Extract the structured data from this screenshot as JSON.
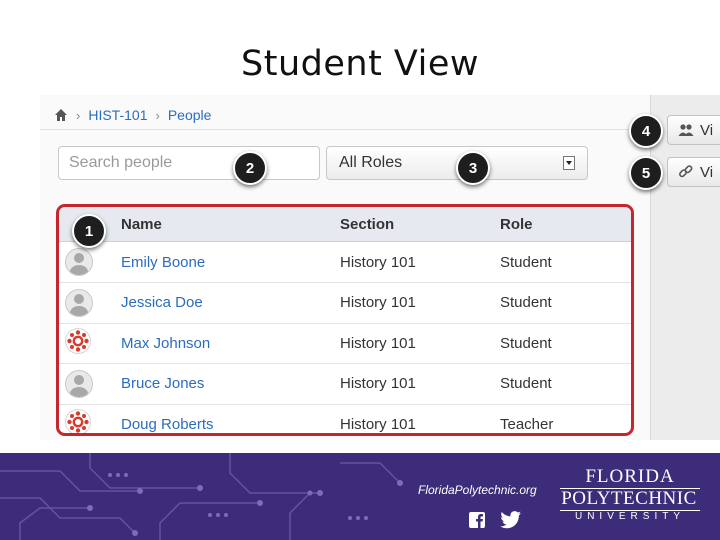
{
  "slide": {
    "title": "Student View"
  },
  "breadcrumb": {
    "items": [
      "HIST-101",
      "People"
    ]
  },
  "search": {
    "placeholder": "Search people"
  },
  "role_filter": {
    "selected": "All Roles"
  },
  "people_table": {
    "headers": [
      "Name",
      "Section",
      "Role"
    ],
    "rows": [
      {
        "avatar": "generic",
        "name": "Emily Boone",
        "section": "History 101",
        "role": "Student"
      },
      {
        "avatar": "generic",
        "name": "Jessica Doe",
        "section": "History 101",
        "role": "Student"
      },
      {
        "avatar": "canvas",
        "name": "Max Johnson",
        "section": "History 101",
        "role": "Student"
      },
      {
        "avatar": "generic",
        "name": "Bruce Jones",
        "section": "History 101",
        "role": "Student"
      },
      {
        "avatar": "canvas",
        "name": "Doug Roberts",
        "section": "History 101",
        "role": "Teacher"
      }
    ]
  },
  "side_buttons": [
    {
      "label": "Vi",
      "icon": "people-group-icon"
    },
    {
      "label": "Vi",
      "icon": "link-icon"
    }
  ],
  "callouts": [
    "1",
    "2",
    "3",
    "4",
    "5"
  ],
  "footer": {
    "url": "FloridaPolytechnic.org",
    "logo_line1": "FLORIDA",
    "logo_line2": "POLYTECHNIC",
    "logo_line3": "UNIVERSITY",
    "social_icons": [
      "facebook-icon",
      "twitter-icon"
    ]
  },
  "colors": {
    "accent_link": "#2a6dbf",
    "highlight_border": "#c4262e",
    "footer_bg": "#3d2c7a",
    "canvas_red": "#d83a2e"
  }
}
